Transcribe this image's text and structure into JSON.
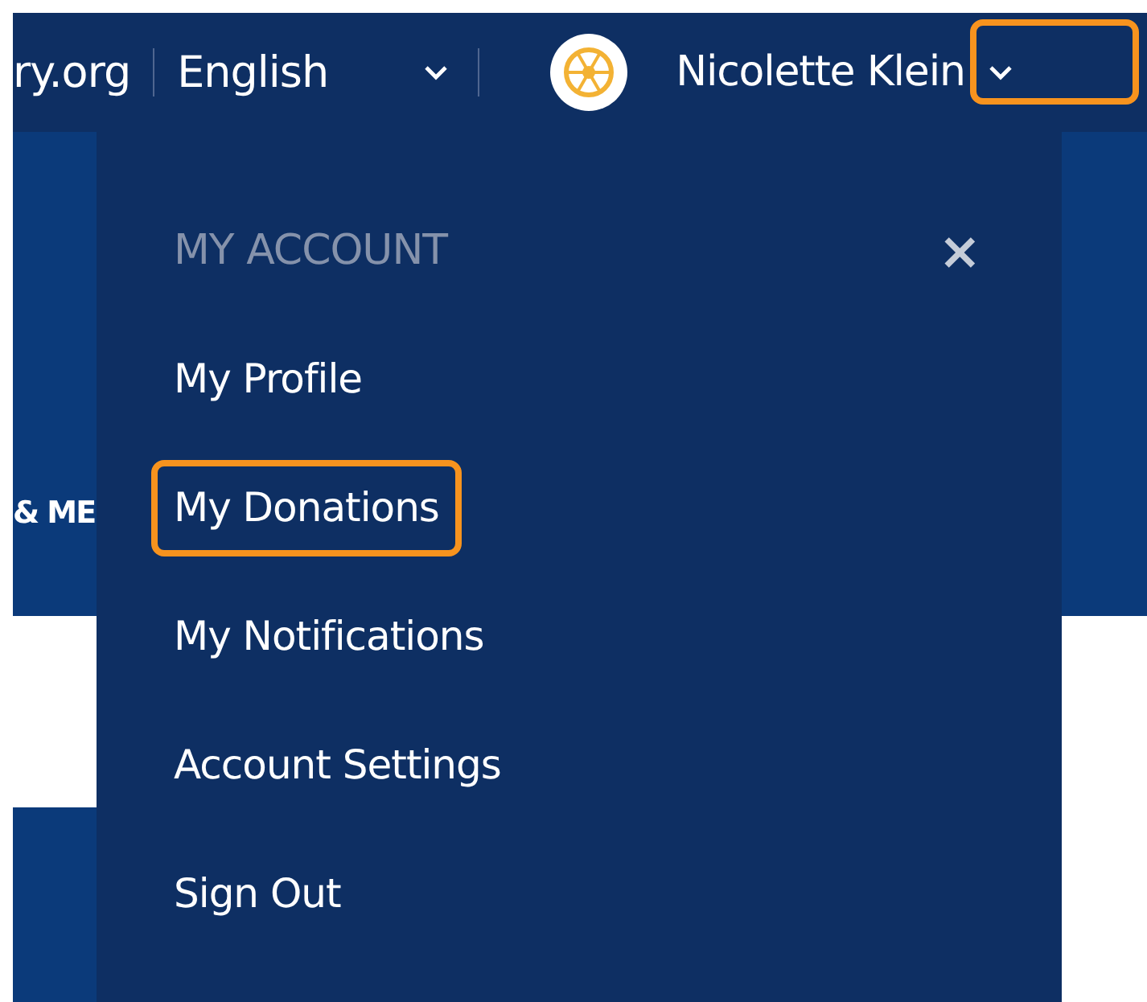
{
  "top_bar": {
    "site": "ry.org",
    "language": "English",
    "user": {
      "name": "Nicolette Klein",
      "highlighted": true
    }
  },
  "band_text": "& ME",
  "menu": {
    "title": "MY ACCOUNT",
    "close": "×",
    "items": [
      {
        "label": "My Profile",
        "highlighted": false
      },
      {
        "label": "My Donations",
        "highlighted": true
      },
      {
        "label": "My Notifications",
        "highlighted": false
      },
      {
        "label": "Account Settings",
        "highlighted": false
      },
      {
        "label": "Sign Out",
        "highlighted": false
      }
    ]
  }
}
